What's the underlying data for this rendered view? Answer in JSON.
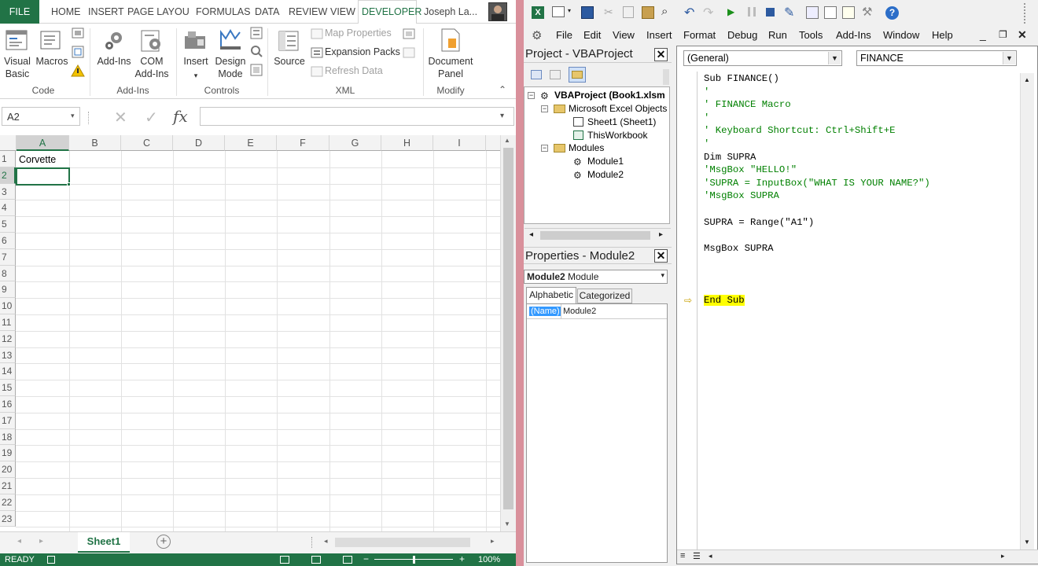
{
  "excel": {
    "tabs": [
      "FILE",
      "HOME",
      "INSERT",
      "PAGE LAYOU",
      "FORMULAS",
      "DATA",
      "REVIEW",
      "VIEW",
      "DEVELOPER"
    ],
    "user": "Joseph La...",
    "ribbon": {
      "code": {
        "visual_basic": "Visual Basic",
        "macros": "Macros",
        "group": "Code"
      },
      "addins": {
        "addins": "Add-Ins",
        "com": "COM Add-Ins",
        "group": "Add-Ins"
      },
      "controls": {
        "insert": "Insert",
        "design": "Design Mode",
        "group": "Controls"
      },
      "xml": {
        "source": "Source",
        "map": "Map Properties",
        "expansion": "Expansion Packs",
        "refresh": "Refresh Data",
        "group": "XML"
      },
      "modify": {
        "document": "Document Panel",
        "group": "Modify"
      }
    },
    "namebox": "A2",
    "fx_symbol": "fx",
    "columns": [
      "A",
      "B",
      "C",
      "D",
      "E",
      "F",
      "G",
      "H",
      "I"
    ],
    "rows": [
      "1",
      "2",
      "3",
      "4",
      "5",
      "6",
      "7",
      "8",
      "9",
      "10",
      "11",
      "12",
      "13",
      "14",
      "15",
      "16",
      "17",
      "18",
      "19",
      "20",
      "21",
      "22",
      "23"
    ],
    "cell_a1": "Corvette",
    "sheet_tab": "Sheet1",
    "status": "READY",
    "zoom": "100%"
  },
  "vbe": {
    "menus": [
      "File",
      "Edit",
      "View",
      "Insert",
      "Format",
      "Debug",
      "Run",
      "Tools",
      "Add-Ins",
      "Window",
      "Help"
    ],
    "project_title": "Project - VBAProject",
    "tree": {
      "root": "VBAProject (Book1.xlsm",
      "excel_objects": "Microsoft Excel Objects",
      "sheet1": "Sheet1 (Sheet1)",
      "thisworkbook": "ThisWorkbook",
      "modules": "Modules",
      "module1": "Module1",
      "module2": "Module2"
    },
    "properties_title": "Properties - Module2",
    "prop_select_bold": "Module2",
    "prop_select_rest": "Module",
    "prop_tabs": [
      "Alphabetic",
      "Categorized"
    ],
    "prop_name_key": "(Name)",
    "prop_name_val": "Module2",
    "combo_left": "(General)",
    "combo_right": "FINANCE",
    "code": [
      {
        "t": "Sub FINANCE()",
        "c": "n"
      },
      {
        "t": "'",
        "c": "c"
      },
      {
        "t": "' FINANCE Macro",
        "c": "c"
      },
      {
        "t": "'",
        "c": "c"
      },
      {
        "t": "' Keyboard Shortcut: Ctrl+Shift+E",
        "c": "c"
      },
      {
        "t": "'",
        "c": "c"
      },
      {
        "t": "Dim SUPRA",
        "c": "n"
      },
      {
        "t": "'MsgBox \"HELLO!\"",
        "c": "c"
      },
      {
        "t": "'SUPRA = InputBox(\"WHAT IS YOUR NAME?\")",
        "c": "c"
      },
      {
        "t": "'MsgBox SUPRA",
        "c": "c"
      },
      {
        "t": "",
        "c": "n"
      },
      {
        "t": "SUPRA = Range(\"A1\")",
        "c": "n"
      },
      {
        "t": "",
        "c": "n"
      },
      {
        "t": "MsgBox SUPRA",
        "c": "n"
      },
      {
        "t": "",
        "c": "n"
      },
      {
        "t": "",
        "c": "n"
      },
      {
        "t": "",
        "c": "n"
      },
      {
        "t": "End Sub",
        "c": "h"
      }
    ]
  }
}
